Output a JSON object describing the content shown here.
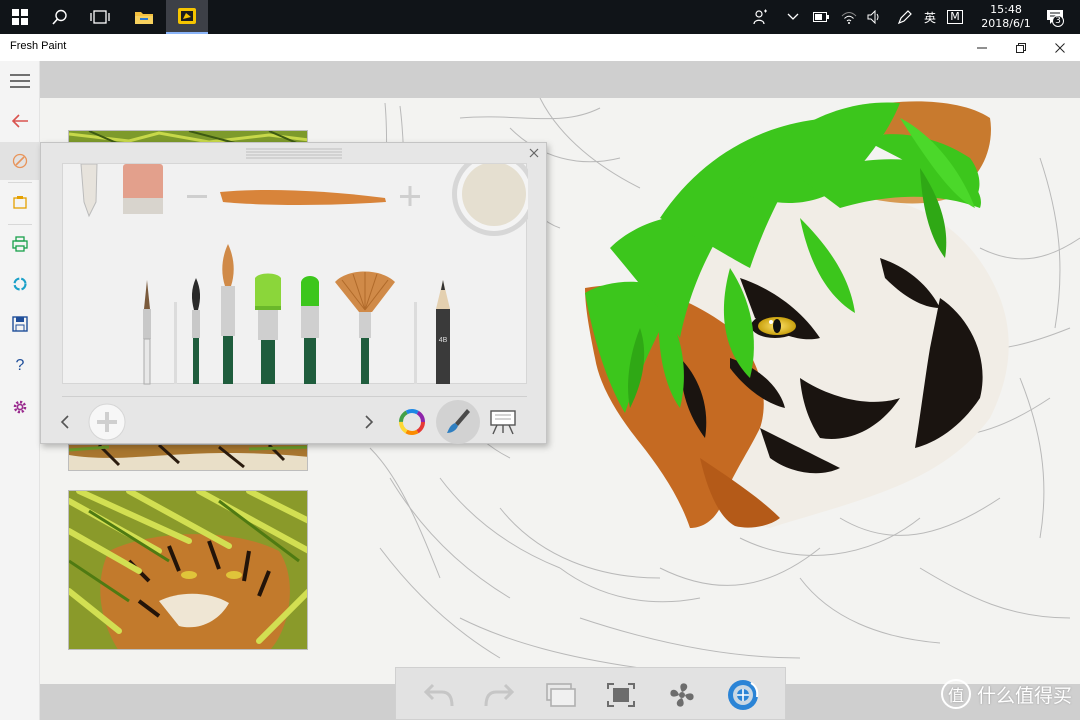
{
  "taskbar": {
    "tray_language": "英",
    "tray_ime": "M",
    "clock_time": "15:48",
    "clock_date": "2018/6/1",
    "notification_count": "3"
  },
  "window": {
    "title": "Fresh Paint"
  },
  "colors": {
    "accent_red": "#d9534f",
    "accent_green": "#18a04a",
    "accent_teal": "#1aa0c8",
    "accent_purple": "#9b2c8f",
    "current_paint_color": "#e5dfd0",
    "brush_stroke_color": "#d8843a",
    "leaf_green": "#3cc61c"
  },
  "left_toolbar": {
    "items": [
      {
        "icon": "hamburger-menu-icon"
      },
      {
        "icon": "back-arrow-icon"
      },
      {
        "icon": "paint-edit-icon"
      },
      {
        "icon": "clipboard-icon"
      },
      {
        "icon": "print-icon"
      },
      {
        "icon": "share-icon"
      },
      {
        "icon": "save-icon"
      },
      {
        "icon": "help-icon"
      },
      {
        "icon": "settings-gear-icon"
      }
    ],
    "help_label": "?"
  },
  "palette": {
    "brushes": [
      "thin-pointed-brush",
      "small-round-brush",
      "long-round-brush",
      "wide-flat-brush",
      "filbert-brush",
      "fan-brush",
      "pencil"
    ],
    "pencil_label": "4B"
  },
  "watermark": {
    "logo_char": "值",
    "text": "什么值得买"
  }
}
